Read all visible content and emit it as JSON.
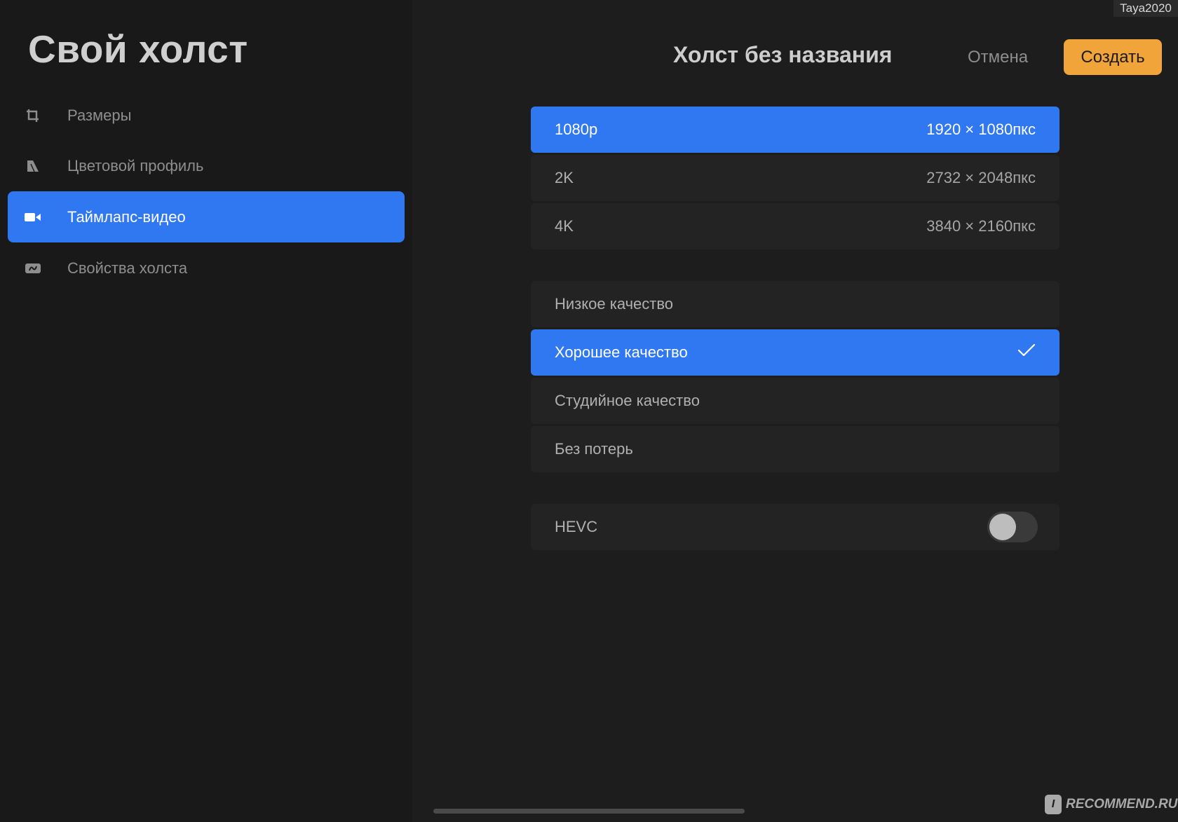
{
  "sidebar": {
    "title": "Свой холст",
    "items": [
      {
        "label": "Размеры",
        "icon": "crop-icon",
        "active": false
      },
      {
        "label": "Цветовой профиль",
        "icon": "color-profile-icon",
        "active": false
      },
      {
        "label": "Таймлапс-видео",
        "icon": "video-camera-icon",
        "active": true
      },
      {
        "label": "Свойства холста",
        "icon": "canvas-properties-icon",
        "active": false
      }
    ]
  },
  "header": {
    "title": "Холст без названия",
    "cancel_label": "Отмена",
    "create_label": "Создать"
  },
  "resolutions": [
    {
      "label": "1080p",
      "value": "1920 × 1080пкс",
      "selected": true
    },
    {
      "label": "2K",
      "value": "2732 × 2048пкс",
      "selected": false
    },
    {
      "label": "4K",
      "value": "3840 × 2160пкс",
      "selected": false
    }
  ],
  "quality": [
    {
      "label": "Низкое качество",
      "selected": false
    },
    {
      "label": "Хорошее качество",
      "selected": true
    },
    {
      "label": "Студийное качество",
      "selected": false
    },
    {
      "label": "Без потерь",
      "selected": false
    }
  ],
  "hevc": {
    "label": "HEVC",
    "enabled": false
  },
  "watermarks": {
    "top": "Taya2020",
    "bottom": "RECOMMEND.RU",
    "bottom_logo": "I"
  },
  "colors": {
    "accent": "#2f78f2",
    "create_button": "#f0a43a",
    "background": "#1d1d1d"
  }
}
